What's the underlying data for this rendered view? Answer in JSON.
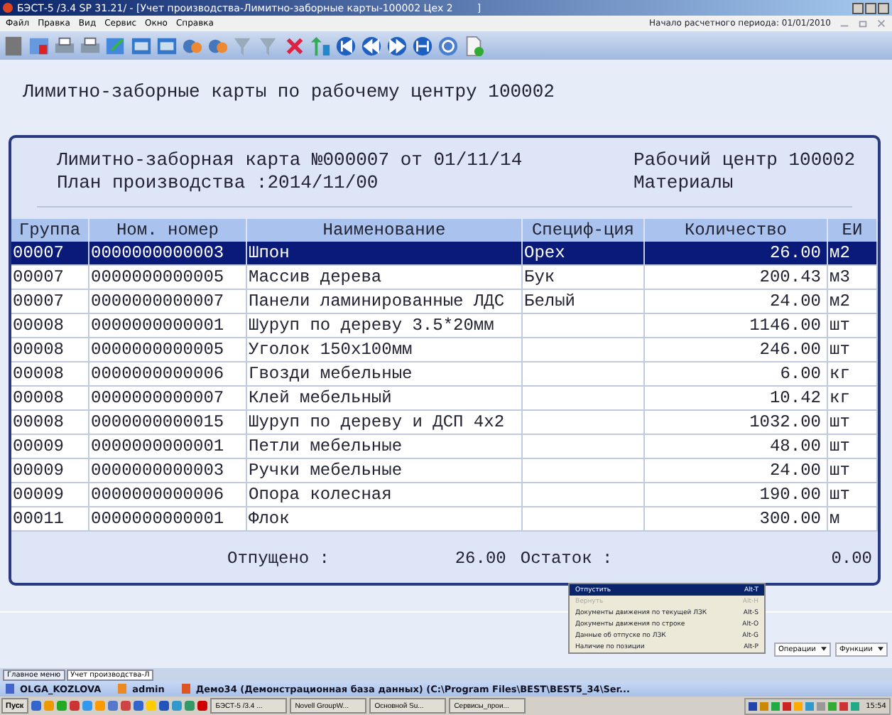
{
  "window": {
    "title": "БЭСТ-5 /3.4 SP 31.21/ - [Учет производства-Лимитно-заборные карты-100002 Цех 2",
    "title_end": "]"
  },
  "menu": [
    "Файл",
    "Правка",
    "Вид",
    "Сервис",
    "Окно",
    "Справка"
  ],
  "period": "Начало расчетного периода: 01/01/2010",
  "heading": "Лимитно-заборные карты по рабочему центру 100002",
  "card": {
    "title": "Лимитно-заборная карта №000007 от 01/11/14",
    "plan": "План производства :2014/11/00",
    "center": "Рабочий центр 100002",
    "type": "Материалы"
  },
  "table": {
    "columns": [
      "Группа",
      "Ном. номер",
      "Наименование",
      "Специф-ция",
      "Количество",
      "ЕИ"
    ],
    "rows": [
      {
        "cells": [
          "00007",
          "0000000000003",
          "Шпон",
          "Орех",
          "26.00",
          "м2"
        ],
        "selected": true
      },
      {
        "cells": [
          "00007",
          "0000000000005",
          "Массив дерева",
          "Бук",
          "200.43",
          "м3"
        ],
        "selected": false
      },
      {
        "cells": [
          "00007",
          "0000000000007",
          "Панели ламинированные ЛДС",
          "Белый",
          "24.00",
          "м2"
        ],
        "selected": false
      },
      {
        "cells": [
          "00008",
          "0000000000001",
          "Шуруп по дереву 3.5*20мм",
          "",
          "1146.00",
          "шт"
        ],
        "selected": false
      },
      {
        "cells": [
          "00008",
          "0000000000005",
          "Уголок 150х100мм",
          "",
          "246.00",
          "шт"
        ],
        "selected": false
      },
      {
        "cells": [
          "00008",
          "0000000000006",
          "Гвозди мебельные",
          "",
          "6.00",
          "кг"
        ],
        "selected": false
      },
      {
        "cells": [
          "00008",
          "0000000000007",
          "Клей мебельный",
          "",
          "10.42",
          "кг"
        ],
        "selected": false
      },
      {
        "cells": [
          "00008",
          "0000000000015",
          "Шуруп по дереву и ДСП 4х2",
          "",
          "1032.00",
          "шт"
        ],
        "selected": false
      },
      {
        "cells": [
          "00009",
          "0000000000001",
          "Петли мебельные",
          "",
          "48.00",
          "шт"
        ],
        "selected": false
      },
      {
        "cells": [
          "00009",
          "0000000000003",
          "Ручки мебельные",
          "",
          "24.00",
          "шт"
        ],
        "selected": false
      },
      {
        "cells": [
          "00009",
          "0000000000006",
          "Опора колесная",
          "",
          "190.00",
          "шт"
        ],
        "selected": false
      },
      {
        "cells": [
          "00011",
          "0000000000001",
          "Флок",
          "",
          "300.00",
          "м"
        ],
        "selected": false
      }
    ]
  },
  "totals": {
    "issued_label": "Отпущено :",
    "issued": "26.00",
    "rest_label": "Остаток :",
    "rest": "0.00"
  },
  "context_menu": [
    {
      "label": "Отпустить",
      "shortcut": "Alt-T",
      "selected": true,
      "disabled": false
    },
    {
      "label": "Вернуть",
      "shortcut": "Alt-H",
      "selected": false,
      "disabled": true
    },
    {
      "label": "Документы движения по текущей ЛЗК",
      "shortcut": "Alt-S",
      "selected": false,
      "disabled": false
    },
    {
      "label": "Документы движения по строке",
      "shortcut": "Alt-O",
      "selected": false,
      "disabled": false
    },
    {
      "label": "Данные об отпуске по ЛЗК",
      "shortcut": "Alt-G",
      "selected": false,
      "disabled": false
    },
    {
      "label": "Наличие по позиции",
      "shortcut": "Alt-P",
      "selected": false,
      "disabled": false
    }
  ],
  "action_buttons": [
    "Операции",
    "Функции"
  ],
  "window_tabs": [
    {
      "label": "Главное меню",
      "selected": false
    },
    {
      "label": "Учет производства-Л",
      "selected": true
    }
  ],
  "status_bar": [
    "OLGA_KOZLOVA",
    "admin",
    "Демо34 (Демонстрационная база данных) (C:\\Program Files\\BEST\\BEST5_34\\Ser..."
  ],
  "taskbar": {
    "start": "Пуск",
    "tasks": [
      "БЭСТ-5 /3.4 ...",
      "Novell GroupW...",
      "Основной Su...",
      "Сервисы_прои..."
    ],
    "clock": "15:54"
  }
}
